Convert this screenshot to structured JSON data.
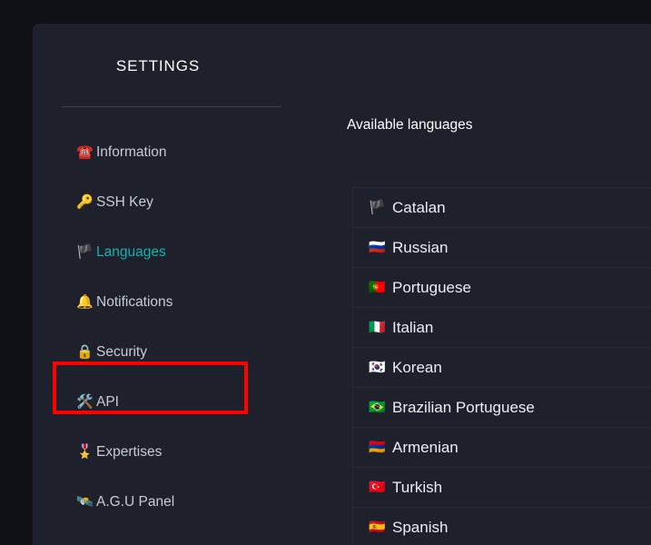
{
  "colors": {
    "page_background": "#101117",
    "card_background": "#1e212b",
    "active_item": "#11b4ae",
    "annotation": "#ff0000",
    "text_primary": "#ffffff",
    "text_secondary": "#c6cbd6",
    "row_border": "#272b36"
  },
  "sidebar": {
    "title": "SETTINGS",
    "items": [
      {
        "label": "Information",
        "icon": "telephone-icon",
        "glyph": "☎️",
        "active": false
      },
      {
        "label": "SSH Key",
        "icon": "key-icon",
        "glyph": "🔑",
        "active": false
      },
      {
        "label": "Languages",
        "icon": "flag-icon",
        "glyph": "🏴",
        "active": true
      },
      {
        "label": "Notifications",
        "icon": "bell-icon",
        "glyph": "🔔",
        "active": false
      },
      {
        "label": "Security",
        "icon": "lock-icon",
        "glyph": "🔒",
        "active": false
      },
      {
        "label": "API",
        "icon": "tools-icon",
        "glyph": "🛠️",
        "active": false
      },
      {
        "label": "Expertises",
        "icon": "medal-icon",
        "glyph": "🎖️",
        "active": false
      },
      {
        "label": "A.G.U Panel",
        "icon": "satellite-icon",
        "glyph": "🛰️",
        "active": false
      }
    ]
  },
  "main": {
    "heading": "Available languages",
    "languages": [
      {
        "name": "Catalan",
        "flag_icon": "flag-catalonia-icon",
        "flag": "🏴"
      },
      {
        "name": "Russian",
        "flag_icon": "flag-russia-icon",
        "flag": "🇷🇺"
      },
      {
        "name": "Portuguese",
        "flag_icon": "flag-portugal-icon",
        "flag": "🇵🇹"
      },
      {
        "name": "Italian",
        "flag_icon": "flag-italy-icon",
        "flag": "🇮🇹"
      },
      {
        "name": "Korean",
        "flag_icon": "flag-south-korea-icon",
        "flag": "🇰🇷"
      },
      {
        "name": "Brazilian Portuguese",
        "flag_icon": "flag-brazil-icon",
        "flag": "🇧🇷"
      },
      {
        "name": "Armenian",
        "flag_icon": "flag-armenia-icon",
        "flag": "🇦🇲"
      },
      {
        "name": "Turkish",
        "flag_icon": "flag-turkey-icon",
        "flag": "🇹🇷"
      },
      {
        "name": "Spanish",
        "flag_icon": "flag-spain-icon",
        "flag": "🇪🇸"
      }
    ]
  }
}
